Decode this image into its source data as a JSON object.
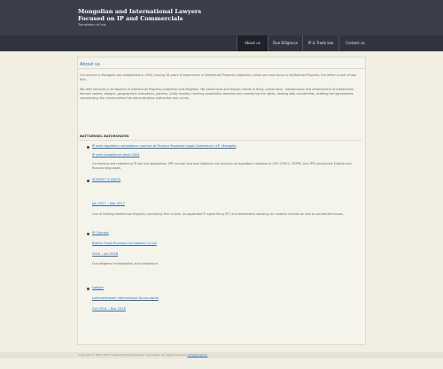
{
  "header": {
    "title_line1": "Mongolian and International Lawyers",
    "title_line2": "Focused on IP and Commercials",
    "tagline": "Translators of law"
  },
  "nav": {
    "items": [
      {
        "label": "About us",
        "active": true
      },
      {
        "label": "Due Diligence",
        "active": false
      },
      {
        "label": "IP & Trade law",
        "active": false
      },
      {
        "label": "Contact us",
        "active": false
      }
    ]
  },
  "main": {
    "heading": "About us",
    "paragraph1": "Our service in Mongolia was established in 2004, having 16 years of experience in Intellectual Property protection, while our main focus is Intellectual Property. Our office is part of law firm.",
    "paragraph2": "We offer services in all aspects of Intellectual Property protection and litigation. We assist local and foreign clients in filing, prosecution, maintenance and enforcement of trademarks, domain names, designs, geographical indications, patents, utility models, tracking availability searches and monitoring the rights, dealing with counterfeits, drafting the agreements, representing the clients before the administrative authorities and courts.",
    "section_title": "BATTSERGEL BATORSHATIN",
    "entries": [
      {
        "link1": "IP and regulatory compliance counsel at Finance Business Legal Conference LLP, Mongolia",
        "link2": "IP and compliance since 2001",
        "text": "Counseling and registering IP law and application, IPR counsel and due diligence risk analysis of regulatory compliance (ISO 27001 / GDPR) plus IPR compliance English and Russian languages."
      },
      {
        "link1": "SCHMITT & DALTA",
        "link2": "Jan 2017 – Mar 2017",
        "text": "One of leading Intellectual Property counseling firm in Asia. As appointed IP agent filing PCT and trademarks advising on customs records as well as counterfeit issues."
      },
      {
        "link1": "IP Counsel",
        "link2": "Batrim Orgel Business Incubation Co Ltd",
        "link3": "2016 – Jan 2018",
        "text": "Due diligence investigation and compliance."
      },
      {
        "link1": "Lawyer",
        "link2": "Lakhamdhasen International Accountants",
        "link3": "Oct 2014 – Dec 2016"
      }
    ]
  },
  "footer": {
    "text": "Copyright © 2004-2020 Intellectual Mongolisation Associates. All rights reserved.",
    "email": "info@ipmgl.mn"
  }
}
